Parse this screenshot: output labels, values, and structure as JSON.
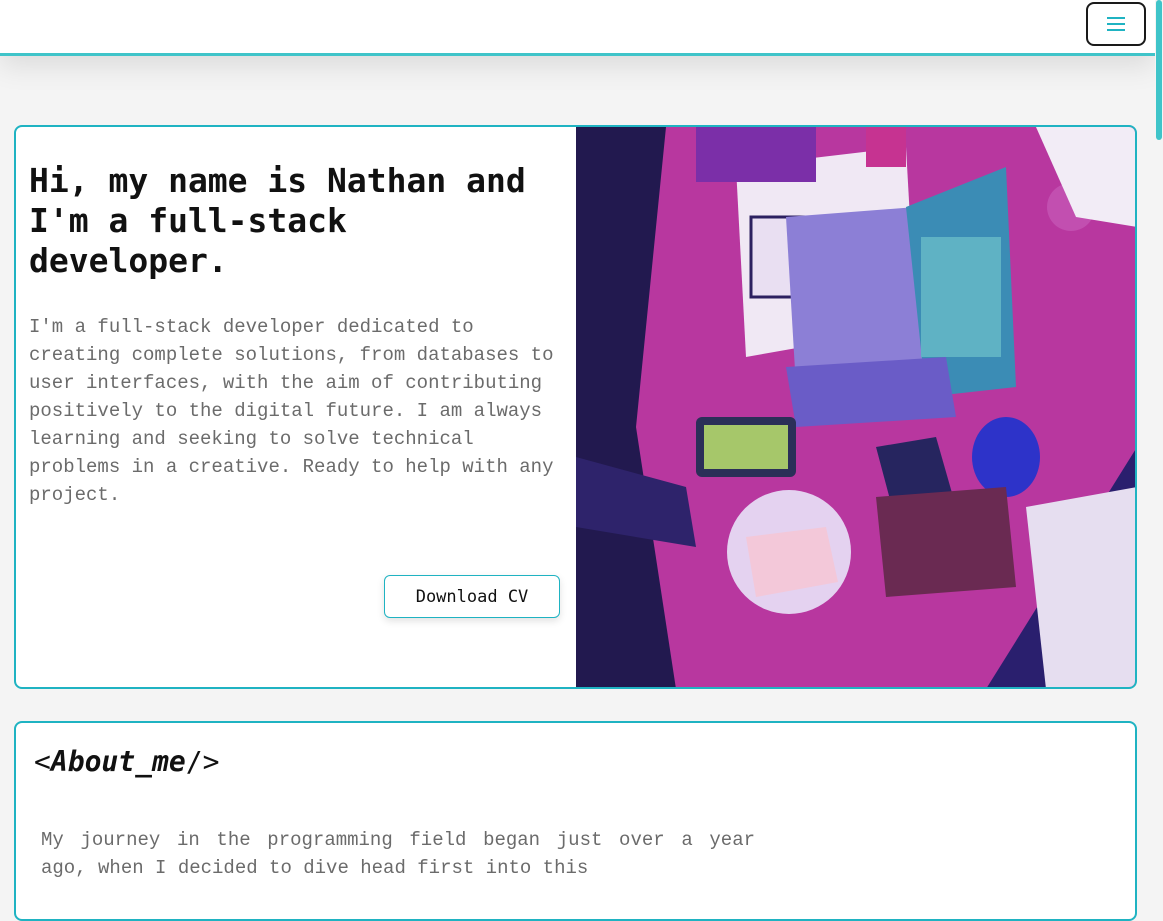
{
  "header": {
    "menu_icon": "hamburger-menu-icon",
    "accent_color": "#3fc4c9"
  },
  "hero": {
    "title": "Hi, my name is Nathan and I'm a full-stack developer.",
    "description": "I'm a full-stack developer dedicated to creating complete solutions, from databases to user interfaces, with the aim of contributing positively to the digital future. I am always learning and seeking to solve technical problems in a creative. Ready to help with any project.",
    "download_label": "Download CV",
    "image_icon": "illustrated-desk-workspace-image"
  },
  "about": {
    "title_open": "<",
    "title_text": "About_me",
    "title_close": "/>",
    "text": "My journey in the programming field began just over a year ago, when I decided to dive head first into this"
  },
  "colors": {
    "border": "#1fb3c2",
    "text_muted": "#6b6b6b",
    "illustration_primary": "#c23aa8",
    "illustration_secondary": "#3a2fb0"
  }
}
